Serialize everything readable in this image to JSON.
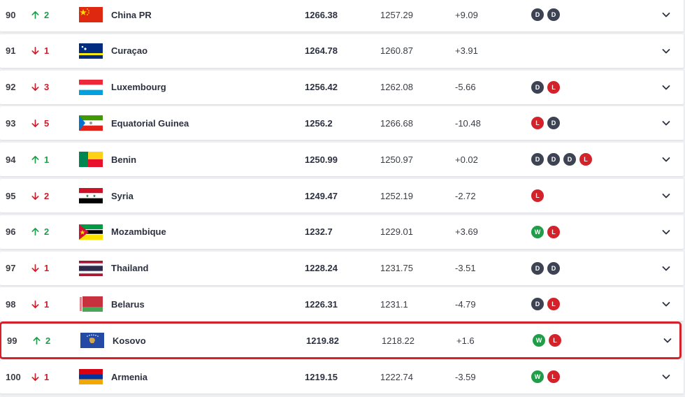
{
  "colors": {
    "up": "#1f9d48",
    "down": "#c8202c",
    "draw": "#3d4352",
    "loss": "#d3222a",
    "win": "#1f9d48",
    "highlight_border": "#d3222a"
  },
  "rows": [
    {
      "rank": "90",
      "dir": "up",
      "move": "2",
      "flag": "china",
      "name": "China PR",
      "points": "1266.38",
      "prev": "1257.29",
      "diff": "+9.09",
      "form": [
        "D",
        "D"
      ],
      "highlighted": false
    },
    {
      "rank": "91",
      "dir": "down",
      "move": "1",
      "flag": "curacao",
      "name": "Curaçao",
      "points": "1264.78",
      "prev": "1260.87",
      "diff": "+3.91",
      "form": [],
      "highlighted": false
    },
    {
      "rank": "92",
      "dir": "down",
      "move": "3",
      "flag": "luxembourg",
      "name": "Luxembourg",
      "points": "1256.42",
      "prev": "1262.08",
      "diff": "-5.66",
      "form": [
        "D",
        "L"
      ],
      "highlighted": false
    },
    {
      "rank": "93",
      "dir": "down",
      "move": "5",
      "flag": "eqguinea",
      "name": "Equatorial Guinea",
      "points": "1256.2",
      "prev": "1266.68",
      "diff": "-10.48",
      "form": [
        "L",
        "D"
      ],
      "highlighted": false
    },
    {
      "rank": "94",
      "dir": "up",
      "move": "1",
      "flag": "benin",
      "name": "Benin",
      "points": "1250.99",
      "prev": "1250.97",
      "diff": "+0.02",
      "form": [
        "D",
        "D",
        "D",
        "L"
      ],
      "highlighted": false
    },
    {
      "rank": "95",
      "dir": "down",
      "move": "2",
      "flag": "syria",
      "name": "Syria",
      "points": "1249.47",
      "prev": "1252.19",
      "diff": "-2.72",
      "form": [
        "L"
      ],
      "highlighted": false
    },
    {
      "rank": "96",
      "dir": "up",
      "move": "2",
      "flag": "mozambique",
      "name": "Mozambique",
      "points": "1232.7",
      "prev": "1229.01",
      "diff": "+3.69",
      "form": [
        "W",
        "L"
      ],
      "highlighted": false
    },
    {
      "rank": "97",
      "dir": "down",
      "move": "1",
      "flag": "thailand",
      "name": "Thailand",
      "points": "1228.24",
      "prev": "1231.75",
      "diff": "-3.51",
      "form": [
        "D",
        "D"
      ],
      "highlighted": false
    },
    {
      "rank": "98",
      "dir": "down",
      "move": "1",
      "flag": "belarus",
      "name": "Belarus",
      "points": "1226.31",
      "prev": "1231.1",
      "diff": "-4.79",
      "form": [
        "D",
        "L"
      ],
      "highlighted": false
    },
    {
      "rank": "99",
      "dir": "up",
      "move": "2",
      "flag": "kosovo",
      "name": "Kosovo",
      "points": "1219.82",
      "prev": "1218.22",
      "diff": "+1.6",
      "form": [
        "W",
        "L"
      ],
      "highlighted": true
    },
    {
      "rank": "100",
      "dir": "down",
      "move": "1",
      "flag": "armenia",
      "name": "Armenia",
      "points": "1219.15",
      "prev": "1222.74",
      "diff": "-3.59",
      "form": [
        "W",
        "L"
      ],
      "highlighted": false
    }
  ]
}
